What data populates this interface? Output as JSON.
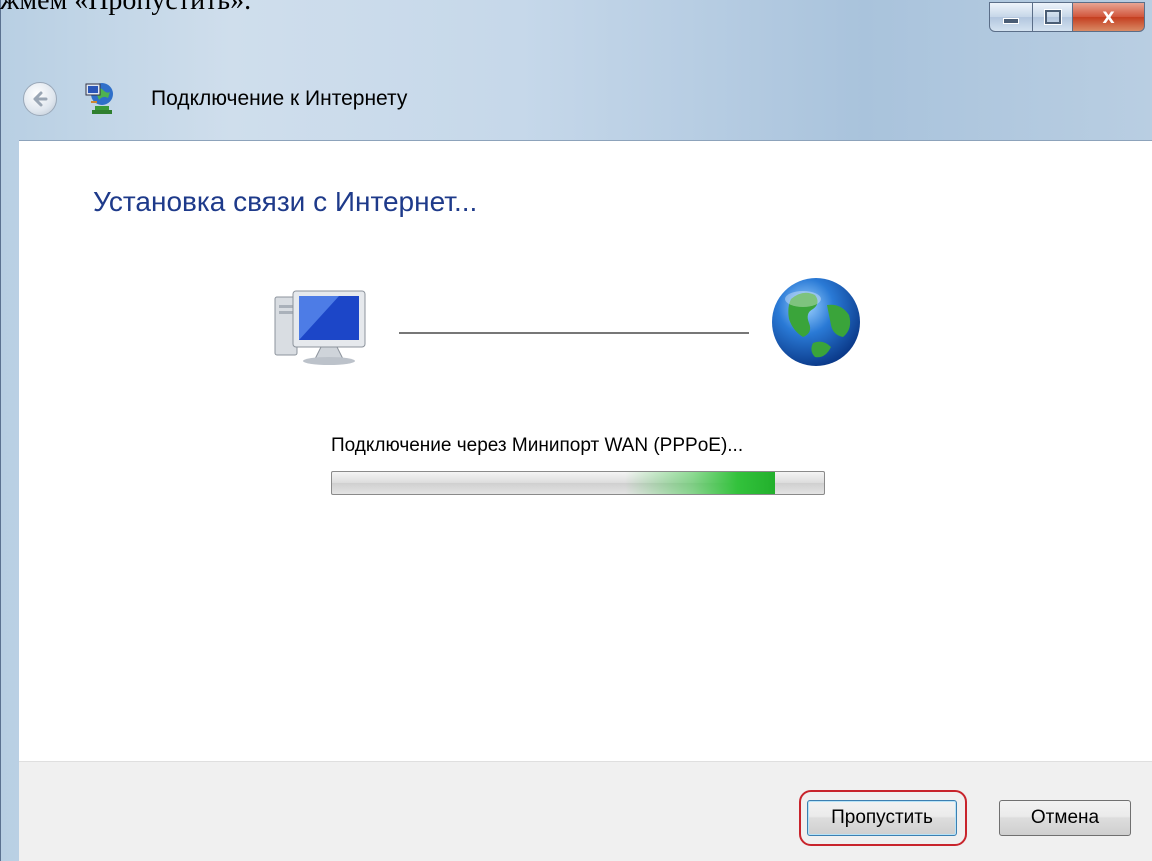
{
  "document": {
    "caption": "жмем «Пропустить»."
  },
  "window": {
    "title": "Подключение к Интернету",
    "controls": {
      "close_glyph": "X"
    }
  },
  "main": {
    "heading": "Установка связи с Интернет...",
    "status_text": "Подключение через Минипорт WAN (PPPoE)...",
    "progress": {
      "indeterminate": true,
      "glow_position_fraction": 0.9,
      "color": "#33c23c"
    }
  },
  "footer": {
    "skip_label": "Пропустить",
    "cancel_label": "Отмена",
    "highlight_color": "#c8242c"
  },
  "icons": {
    "back": "back-arrow-icon",
    "app": "network-connection-icon",
    "computer": "computer-icon",
    "internet": "globe-icon"
  }
}
